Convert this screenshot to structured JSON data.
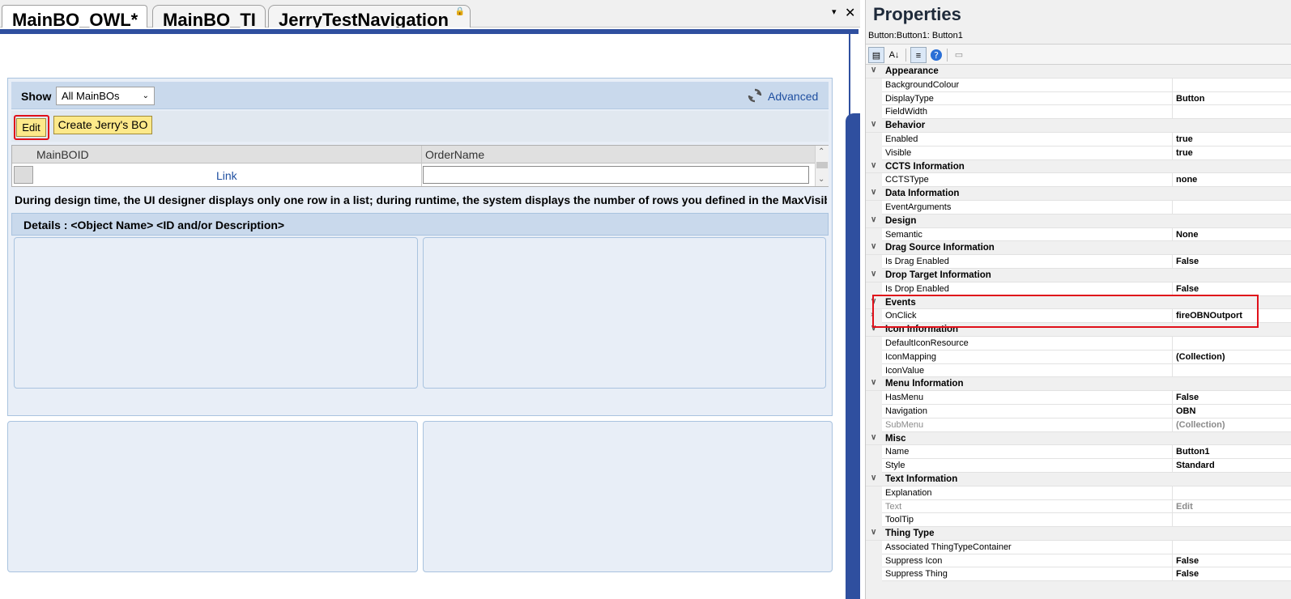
{
  "tabs": [
    {
      "label": "MainBO_OWL*"
    },
    {
      "label": "MainBO_TI"
    },
    {
      "label": "JerryTestNavigation",
      "lock": "🔒"
    }
  ],
  "tab_controls": {
    "menu": "▾",
    "close": "✕"
  },
  "designer": {
    "show_label": "Show",
    "show_select": "All MainBOs",
    "advanced": "Advanced",
    "edit_button": "Edit",
    "create_button": "Create Jerry's BO",
    "columns": [
      "MainBOID",
      "OrderName"
    ],
    "row_link": "Link",
    "design_note": "During design time, the UI designer displays only one row in a list; during runtime, the system displays the number of rows you defined in the MaxVisibleRo",
    "details_title": "Details : <Object Name> <ID and/or Description>"
  },
  "properties": {
    "title": "Properties",
    "object": "Button:Button1: Button1",
    "toolbar": {
      "cat": "▤",
      "alpha": "A↓",
      "props": "≡",
      "help": "?",
      "pages": "▭"
    },
    "groups": [
      {
        "name": "Appearance",
        "items": [
          {
            "name": "BackgroundColour",
            "value": ""
          },
          {
            "name": "DisplayType",
            "value": "Button"
          },
          {
            "name": "FieldWidth",
            "value": ""
          }
        ]
      },
      {
        "name": "Behavior",
        "items": [
          {
            "name": "Enabled",
            "value": "true"
          },
          {
            "name": "Visible",
            "value": "true"
          }
        ]
      },
      {
        "name": "CCTS Information",
        "items": [
          {
            "name": "CCTSType",
            "value": "none"
          }
        ]
      },
      {
        "name": "Data Information",
        "items": [
          {
            "name": "EventArguments",
            "value": ""
          }
        ]
      },
      {
        "name": "Design",
        "items": [
          {
            "name": "Semantic",
            "value": "None"
          }
        ]
      },
      {
        "name": "Drag Source Information",
        "items": [
          {
            "name": "Is Drag Enabled",
            "value": "False"
          }
        ]
      },
      {
        "name": "Drop Target Information",
        "items": [
          {
            "name": "Is Drop Enabled",
            "value": "False"
          }
        ]
      },
      {
        "name": "Events",
        "items": [
          {
            "name": "OnClick",
            "value": "fireOBNOutport",
            "expandable": true
          }
        ]
      },
      {
        "name": "Icon Information",
        "items": [
          {
            "name": "DefaultIconResource",
            "value": ""
          },
          {
            "name": "IconMapping",
            "value": "(Collection)"
          },
          {
            "name": "IconValue",
            "value": ""
          }
        ]
      },
      {
        "name": "Menu Information",
        "items": [
          {
            "name": "HasMenu",
            "value": "False"
          },
          {
            "name": "Navigation",
            "value": "OBN"
          },
          {
            "name": "SubMenu",
            "value": "(Collection)",
            "disabled": true
          }
        ]
      },
      {
        "name": "Misc",
        "items": [
          {
            "name": "Name",
            "value": "Button1"
          },
          {
            "name": "Style",
            "value": "Standard"
          }
        ]
      },
      {
        "name": "Text Information",
        "items": [
          {
            "name": "Explanation",
            "value": ""
          },
          {
            "name": "Text",
            "value": "Edit",
            "disabled": true
          },
          {
            "name": "ToolTip",
            "value": ""
          }
        ]
      },
      {
        "name": "Thing Type",
        "items": [
          {
            "name": "Associated ThingTypeContainer",
            "value": ""
          },
          {
            "name": "Suppress Icon",
            "value": "False"
          },
          {
            "name": "Suppress Thing",
            "value": "False"
          }
        ]
      }
    ],
    "collapse_glyph": "∨",
    "expand_glyph": "›"
  },
  "colors": {
    "frame": "#2f4f9f",
    "highlight": "#e0101a",
    "button_yellow": "#fde98a",
    "link": "#1f4fa0"
  }
}
